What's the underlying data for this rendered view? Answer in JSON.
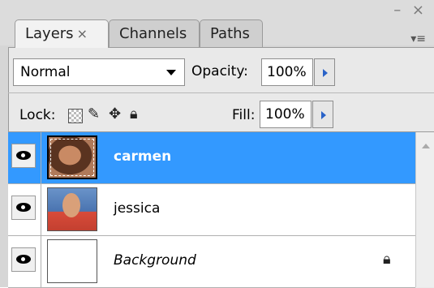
{
  "window": {
    "controls": "– ×",
    "menu": "▾≡"
  },
  "tabs": [
    {
      "label": "Layers",
      "close": "×"
    },
    {
      "label": "Channels"
    },
    {
      "label": "Paths"
    }
  ],
  "blend_mode": {
    "selected": "Normal"
  },
  "opacity": {
    "label": "Opacity:",
    "value": "100%"
  },
  "lock": {
    "label": "Lock:",
    "icons": [
      "lock-transparent-icon",
      "lock-brush-icon",
      "lock-move-icon",
      "lock-all-icon"
    ]
  },
  "fill": {
    "label": "Fill:",
    "value": "100%"
  },
  "layers": [
    {
      "name": "carmen",
      "selected": true,
      "visible": true
    },
    {
      "name": "jessica",
      "selected": false,
      "visible": true
    },
    {
      "name": "Background",
      "selected": false,
      "visible": true,
      "locked": true
    }
  ],
  "colors": {
    "selection": "#3399ff",
    "arrow": "#2a63c8"
  }
}
